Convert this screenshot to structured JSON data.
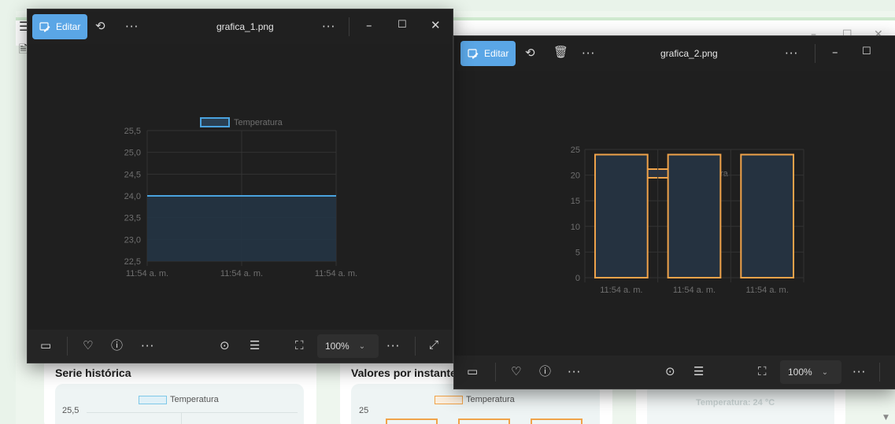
{
  "background_app": {
    "window_controls": [
      "–",
      "☐",
      "✕"
    ],
    "sections": [
      {
        "title": "Serie histórica",
        "legend": "Temperatura",
        "first_tick": "25,5",
        "legend_color": "#7ec8e8"
      },
      {
        "title": "Valores por instante",
        "legend": "Temperatura",
        "first_tick": "25",
        "legend_color": "#f0a34a"
      },
      {
        "faded_text": "Temperatura: 24 °C"
      }
    ]
  },
  "viewers": [
    {
      "filename": "grafica_1.png",
      "edit_label": "Editar",
      "zoom": "100%",
      "titlebar_more": "···",
      "toolbar_more": "···",
      "bottom_more": "···",
      "bottom_more2": "···",
      "controls": [
        "–",
        "☐",
        "✕"
      ],
      "accent": "#5aa6e6"
    },
    {
      "filename": "grafica_2.png",
      "edit_label": "Editar",
      "zoom": "100%",
      "titlebar_more": "···",
      "toolbar_more": "···",
      "bottom_more": "···",
      "bottom_more2": "···",
      "controls": [
        "–",
        "☐"
      ],
      "accent": "#5aa6e6"
    }
  ],
  "chart_data": [
    {
      "type": "area",
      "legend": "Temperatura",
      "line_color": "#4aa3df",
      "categories": [
        "11:54 a. m.",
        "11:54 a. m.",
        "11:54 a. m."
      ],
      "values": [
        24,
        24,
        24
      ],
      "yticks": [
        "25,5",
        "25,0",
        "24,5",
        "24,0",
        "23,5",
        "23,0",
        "22,5"
      ],
      "ylim": [
        22.5,
        25.5
      ],
      "grid": true
    },
    {
      "type": "bar",
      "legend": "Temperatura",
      "bar_color": "#f0a34a",
      "categories": [
        "11:54 a. m.",
        "11:54 a. m.",
        "11:54 a. m."
      ],
      "values": [
        24,
        24,
        24
      ],
      "yticks": [
        "25",
        "20",
        "15",
        "10",
        "5",
        "0"
      ],
      "ylim": [
        0,
        25
      ],
      "grid": true
    }
  ]
}
